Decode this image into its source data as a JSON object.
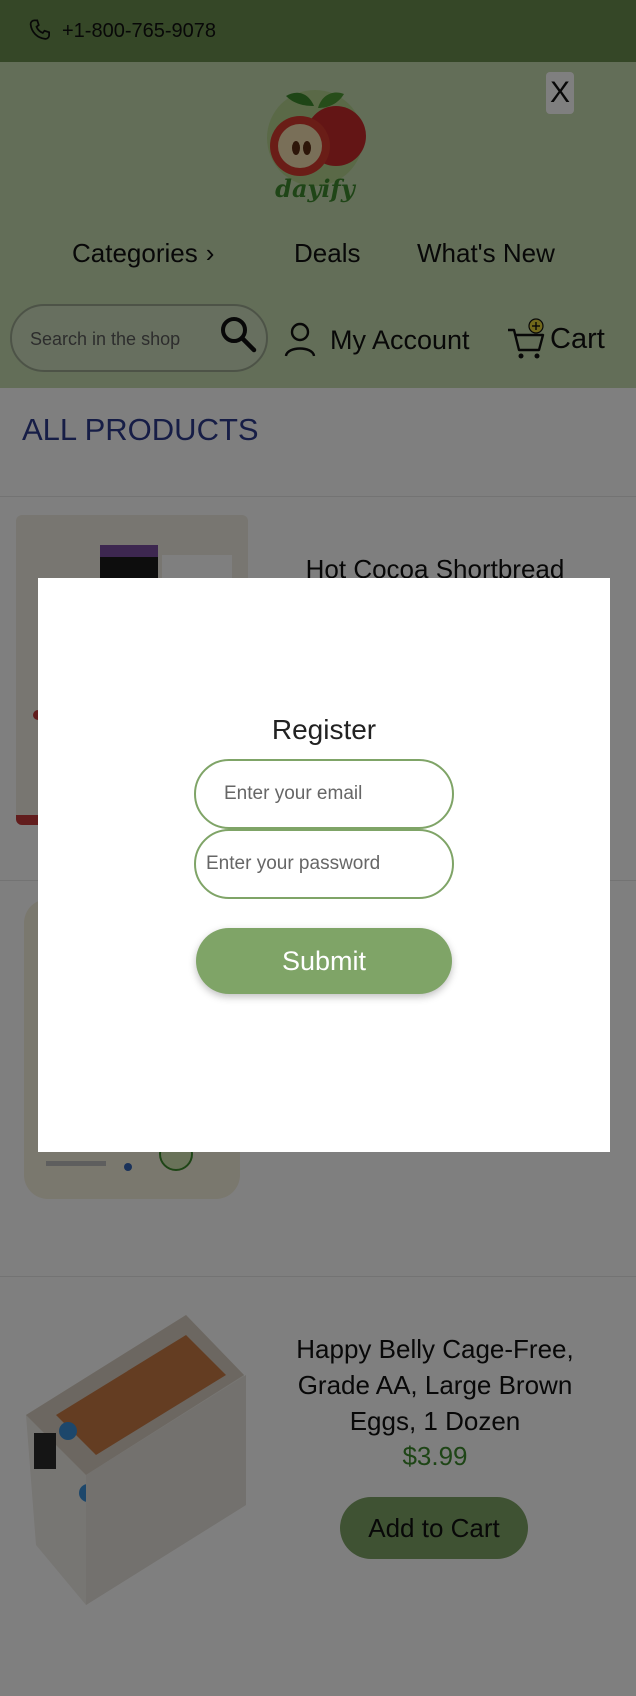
{
  "topbar": {
    "phone": "+1-800-765-9078",
    "icon": "phone-icon"
  },
  "brand": {
    "name": "dayify"
  },
  "header": {
    "close_label": "X"
  },
  "nav": {
    "categories": "Categories",
    "deals": "Deals",
    "whats_new": "What's New"
  },
  "search": {
    "placeholder": "Search in the shop"
  },
  "account": {
    "label": "My Account"
  },
  "cart": {
    "label": "Cart"
  },
  "main": {
    "title": "ALL PRODUCTS"
  },
  "products": [
    {
      "name": "Hot Cocoa Shortbread"
    },
    {
      "name": ""
    },
    {
      "name": "Happy Belly Cage-Free, Grade AA, Large Brown Eggs, 1 Dozen",
      "price": "$3.99",
      "button": "Add to Cart"
    }
  ],
  "modal": {
    "title": "Register",
    "email_placeholder": "Enter your email",
    "password_placeholder": "Enter your password",
    "submit_label": "Submit"
  },
  "colors": {
    "accent": "#7fa467",
    "topbar": "#6b8e4e",
    "header": "#c6dcb0",
    "heading": "#2c3b8c",
    "price": "#3d8a2c"
  }
}
